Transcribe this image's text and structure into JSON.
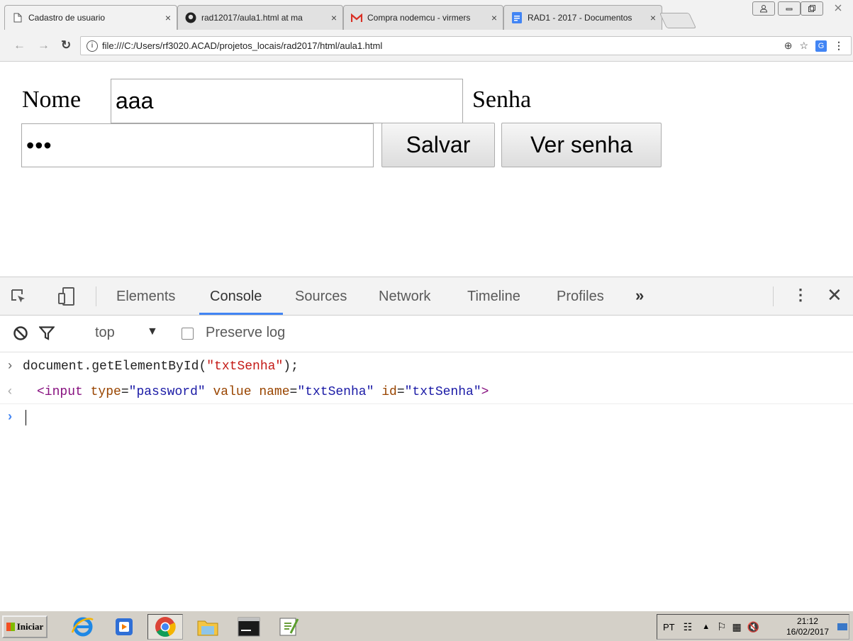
{
  "browser": {
    "tabs": [
      {
        "title": "Cadastro de usuario",
        "icon": "page-icon",
        "active": true
      },
      {
        "title": "rad12017/aula1.html at ma",
        "icon": "github-icon",
        "active": false
      },
      {
        "title": "Compra nodemcu - virmers",
        "icon": "gmail-icon",
        "active": false
      },
      {
        "title": "RAD1 - 2017 - Documentos",
        "icon": "docs-icon",
        "active": false
      }
    ],
    "close_glyph": "×",
    "address": "file:///C:/Users/rf3020.ACAD/projetos_locais/rad2017/html/aula1.html"
  },
  "form": {
    "nome_label": "Nome",
    "nome_value": "aaa",
    "senha_label": "Senha",
    "senha_masked": "•••",
    "salvar_label": "Salvar",
    "ver_senha_label": "Ver senha"
  },
  "devtools": {
    "tabs": [
      "Elements",
      "Console",
      "Sources",
      "Network",
      "Timeline",
      "Profiles"
    ],
    "active_tab": "Console",
    "more_glyph": "»",
    "context": "top",
    "preserve_log_label": "Preserve log",
    "console": {
      "command_prefix": "document.getElementById(",
      "command_arg": "\"txtSenha\"",
      "command_suffix": ");",
      "result": {
        "tag_open": "<input",
        "attrs": [
          {
            "name": "type",
            "value": "\"password\""
          },
          {
            "name": "value",
            "value": ""
          },
          {
            "name": "name",
            "value": "\"txtSenha\""
          },
          {
            "name": "id",
            "value": "\"txtSenha\""
          }
        ],
        "tag_close": ">"
      }
    }
  },
  "taskbar": {
    "start_label": "Iniciar",
    "language": "PT",
    "time": "21:12",
    "date": "16/02/2017"
  },
  "colors": {
    "accent": "#4285f4",
    "tag": "#881280",
    "attr": "#994500",
    "value": "#1a1aa6",
    "string": "#c41a16"
  }
}
